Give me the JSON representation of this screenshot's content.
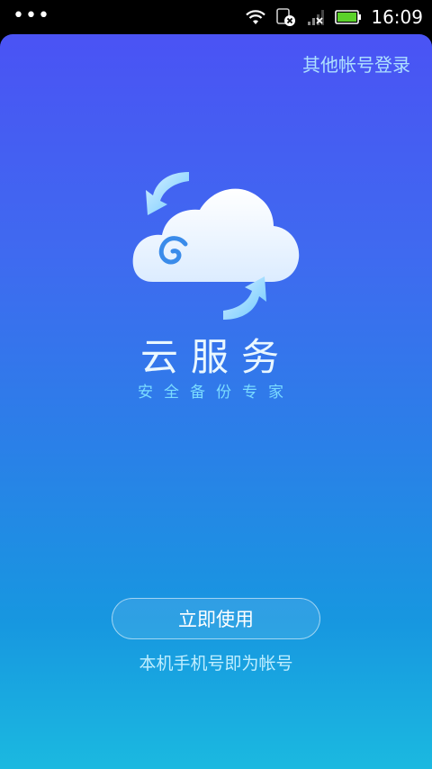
{
  "status_bar": {
    "time": "16:09",
    "icons": [
      "menu-dots-icon",
      "wifi-icon",
      "sim-error-icon",
      "signal-no-service-icon",
      "battery-icon"
    ]
  },
  "header": {
    "other_login_label": "其他帐号登录"
  },
  "logo": {
    "icon": "cloud-sync-icon"
  },
  "app": {
    "title": "云服务",
    "subtitle": "安全备份专家"
  },
  "actions": {
    "use_button_label": "立即使用",
    "hint": "本机手机号即为帐号"
  },
  "colors": {
    "gradient_top": "#4a53f4",
    "gradient_bottom": "#1bb9e0",
    "subtitle": "#7bdcff",
    "link": "#aee0ff"
  }
}
